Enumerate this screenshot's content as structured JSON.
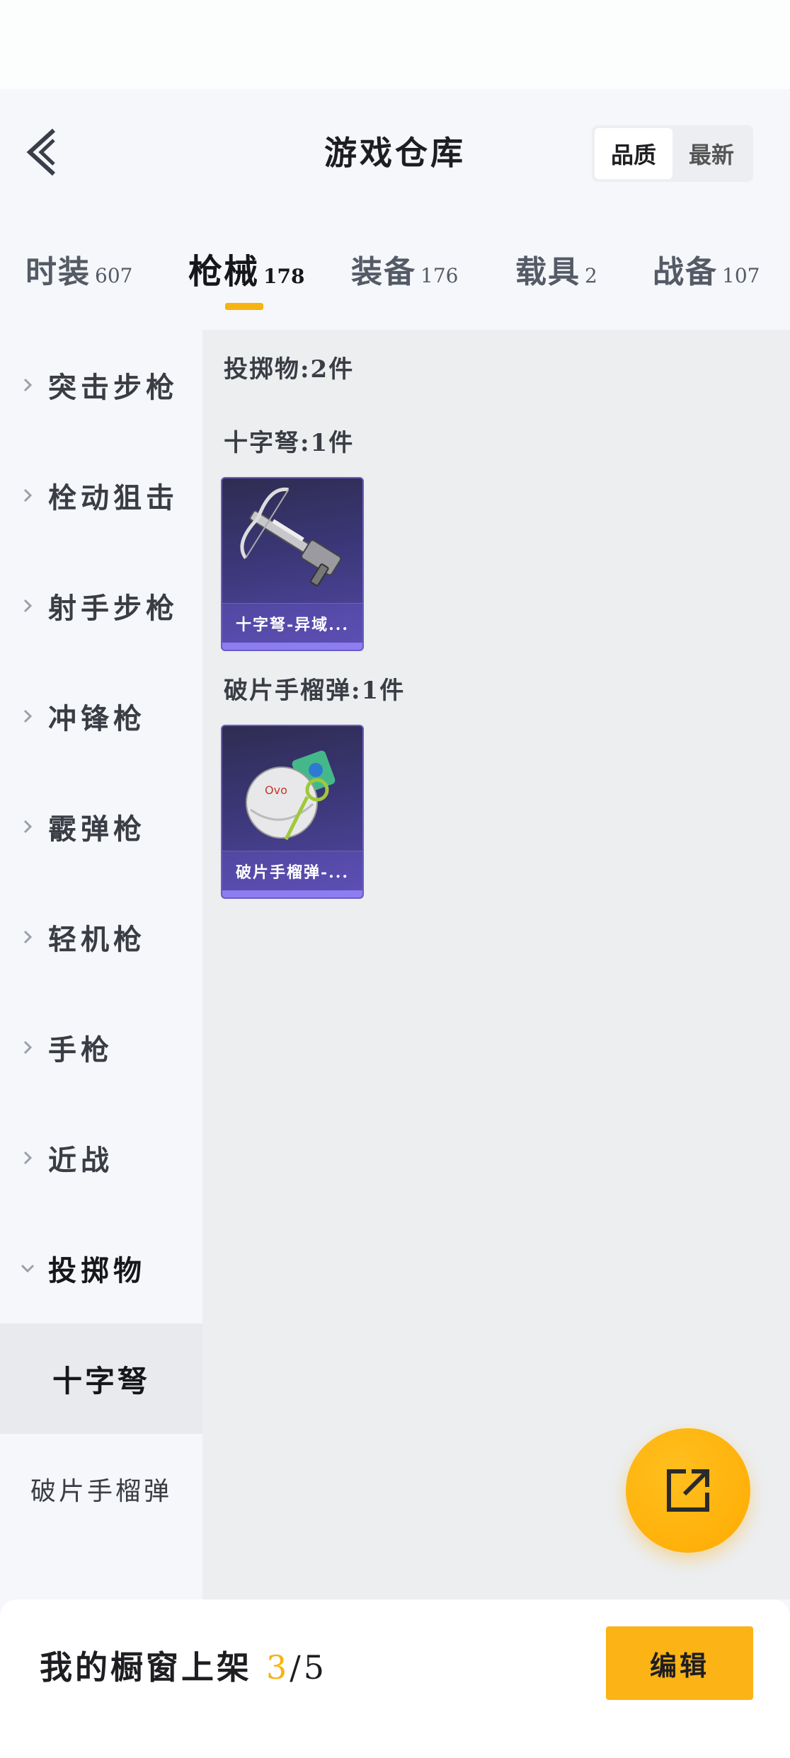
{
  "header": {
    "title": "游戏仓库",
    "sort_options": [
      "品质",
      "最新"
    ],
    "sort_active": "品质"
  },
  "tabs": [
    {
      "label": "时装",
      "count": "607"
    },
    {
      "label": "枪械",
      "count": "178",
      "active": true
    },
    {
      "label": "装备",
      "count": "176"
    },
    {
      "label": "载具",
      "count": "2"
    },
    {
      "label": "战备",
      "count": "107"
    }
  ],
  "sidebar": {
    "items": [
      {
        "label": "突击步枪"
      },
      {
        "label": "栓动狙击"
      },
      {
        "label": "射手步枪"
      },
      {
        "label": "冲锋枪"
      },
      {
        "label": "霰弹枪"
      },
      {
        "label": "轻机枪"
      },
      {
        "label": "手枪"
      },
      {
        "label": "近战"
      },
      {
        "label": "投掷物",
        "expanded": true
      }
    ],
    "sub_items": [
      {
        "label": "十字弩",
        "active": true
      },
      {
        "label": "破片手榴弹"
      }
    ]
  },
  "content": {
    "category_summary": "投掷物:2件",
    "groups": [
      {
        "title": "十字弩:1件",
        "items": [
          {
            "name": "十字弩-异域...",
            "icon": "crossbow-icon"
          }
        ]
      },
      {
        "title": "破片手榴弹:1件",
        "items": [
          {
            "name": "破片手榴弹-...",
            "icon": "grenade-icon"
          }
        ]
      }
    ]
  },
  "footer": {
    "text_prefix": "我的橱窗上架",
    "shown": "3",
    "total": "/5",
    "edit_label": "编辑"
  },
  "colors": {
    "accent": "#f6b311",
    "fab": "#ffab00",
    "card": "#3b3778"
  }
}
